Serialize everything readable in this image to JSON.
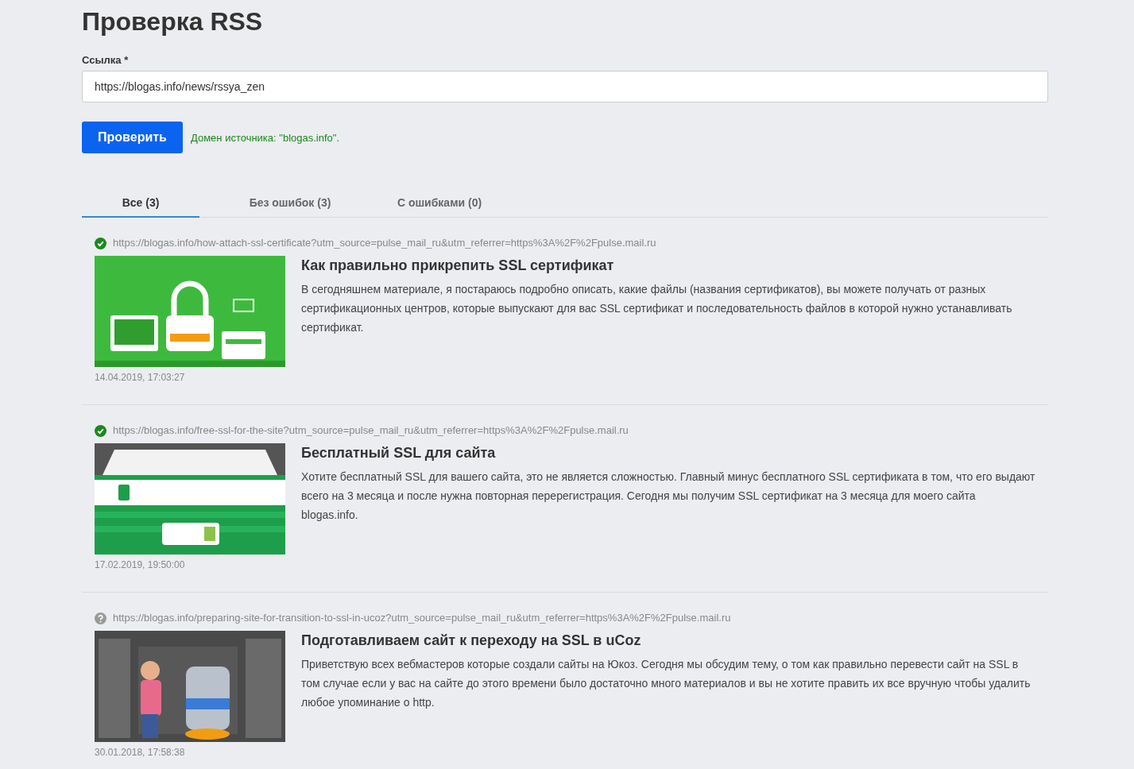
{
  "title": "Проверка RSS",
  "link_field": {
    "label": "Ссылка *",
    "value": "https://blogas.info/news/rssya_zen"
  },
  "check_button": "Проверить",
  "domain_message": "Домен источника: \"blogas.info\".",
  "tabs": [
    {
      "label": "Все (3)",
      "selected": true
    },
    {
      "label": "Без ошибок (3)",
      "selected": false
    },
    {
      "label": "С ошибками (0)",
      "selected": false
    }
  ],
  "items": [
    {
      "verified": true,
      "url": "https://blogas.info/how-attach-ssl-certificate?utm_source=pulse_mail_ru&utm_referrer=https%3A%2F%2Fpulse.mail.ru",
      "title": "Как правильно прикрепить SSL сертификат",
      "text": "В сегодняшнем материале, я постараюсь подробно описать, какие файлы (названия сертификатов), вы можете получать от разных сертификационных центров, которые выпускают для вас SSL сертификат и последовательность файлов в которой нужно устанавливать сертификат.",
      "date": "14.04.2019, 17:03:27"
    },
    {
      "verified": true,
      "url": "https://blogas.info/free-ssl-for-the-site?utm_source=pulse_mail_ru&utm_referrer=https%3A%2F%2Fpulse.mail.ru",
      "title": "Бесплатный SSL для сайта",
      "text": "Хотите бесплатный SSL для вашего сайта, это не является сложностью. Главный минус бесплатного SSL сертификата в том, что его выдают всего на 3 месяца и после нужна повторная перерегистрация. Сегодня мы получим SSL сертификат на 3 месяца для моего сайта blogas.info.",
      "date": "17.02.2019, 19:50:00"
    },
    {
      "verified": false,
      "url": "https://blogas.info/preparing-site-for-transition-to-ssl-in-ucoz?utm_source=pulse_mail_ru&utm_referrer=https%3A%2F%2Fpulse.mail.ru",
      "title": "Подготавливаем сайт к переходу на SSL в uCoz",
      "text": "Приветствую всех вебмастеров которые создали сайты на Юкоз. Сегодня мы обсудим тему, о том как правильно перевести сайт на SSL в том случае если у вас на сайте до этого времени было достаточно много материалов и вы не хотите править их все вручную чтобы удалить любое упоминание о http.",
      "date": "30.01.2018, 17:58:38"
    }
  ]
}
